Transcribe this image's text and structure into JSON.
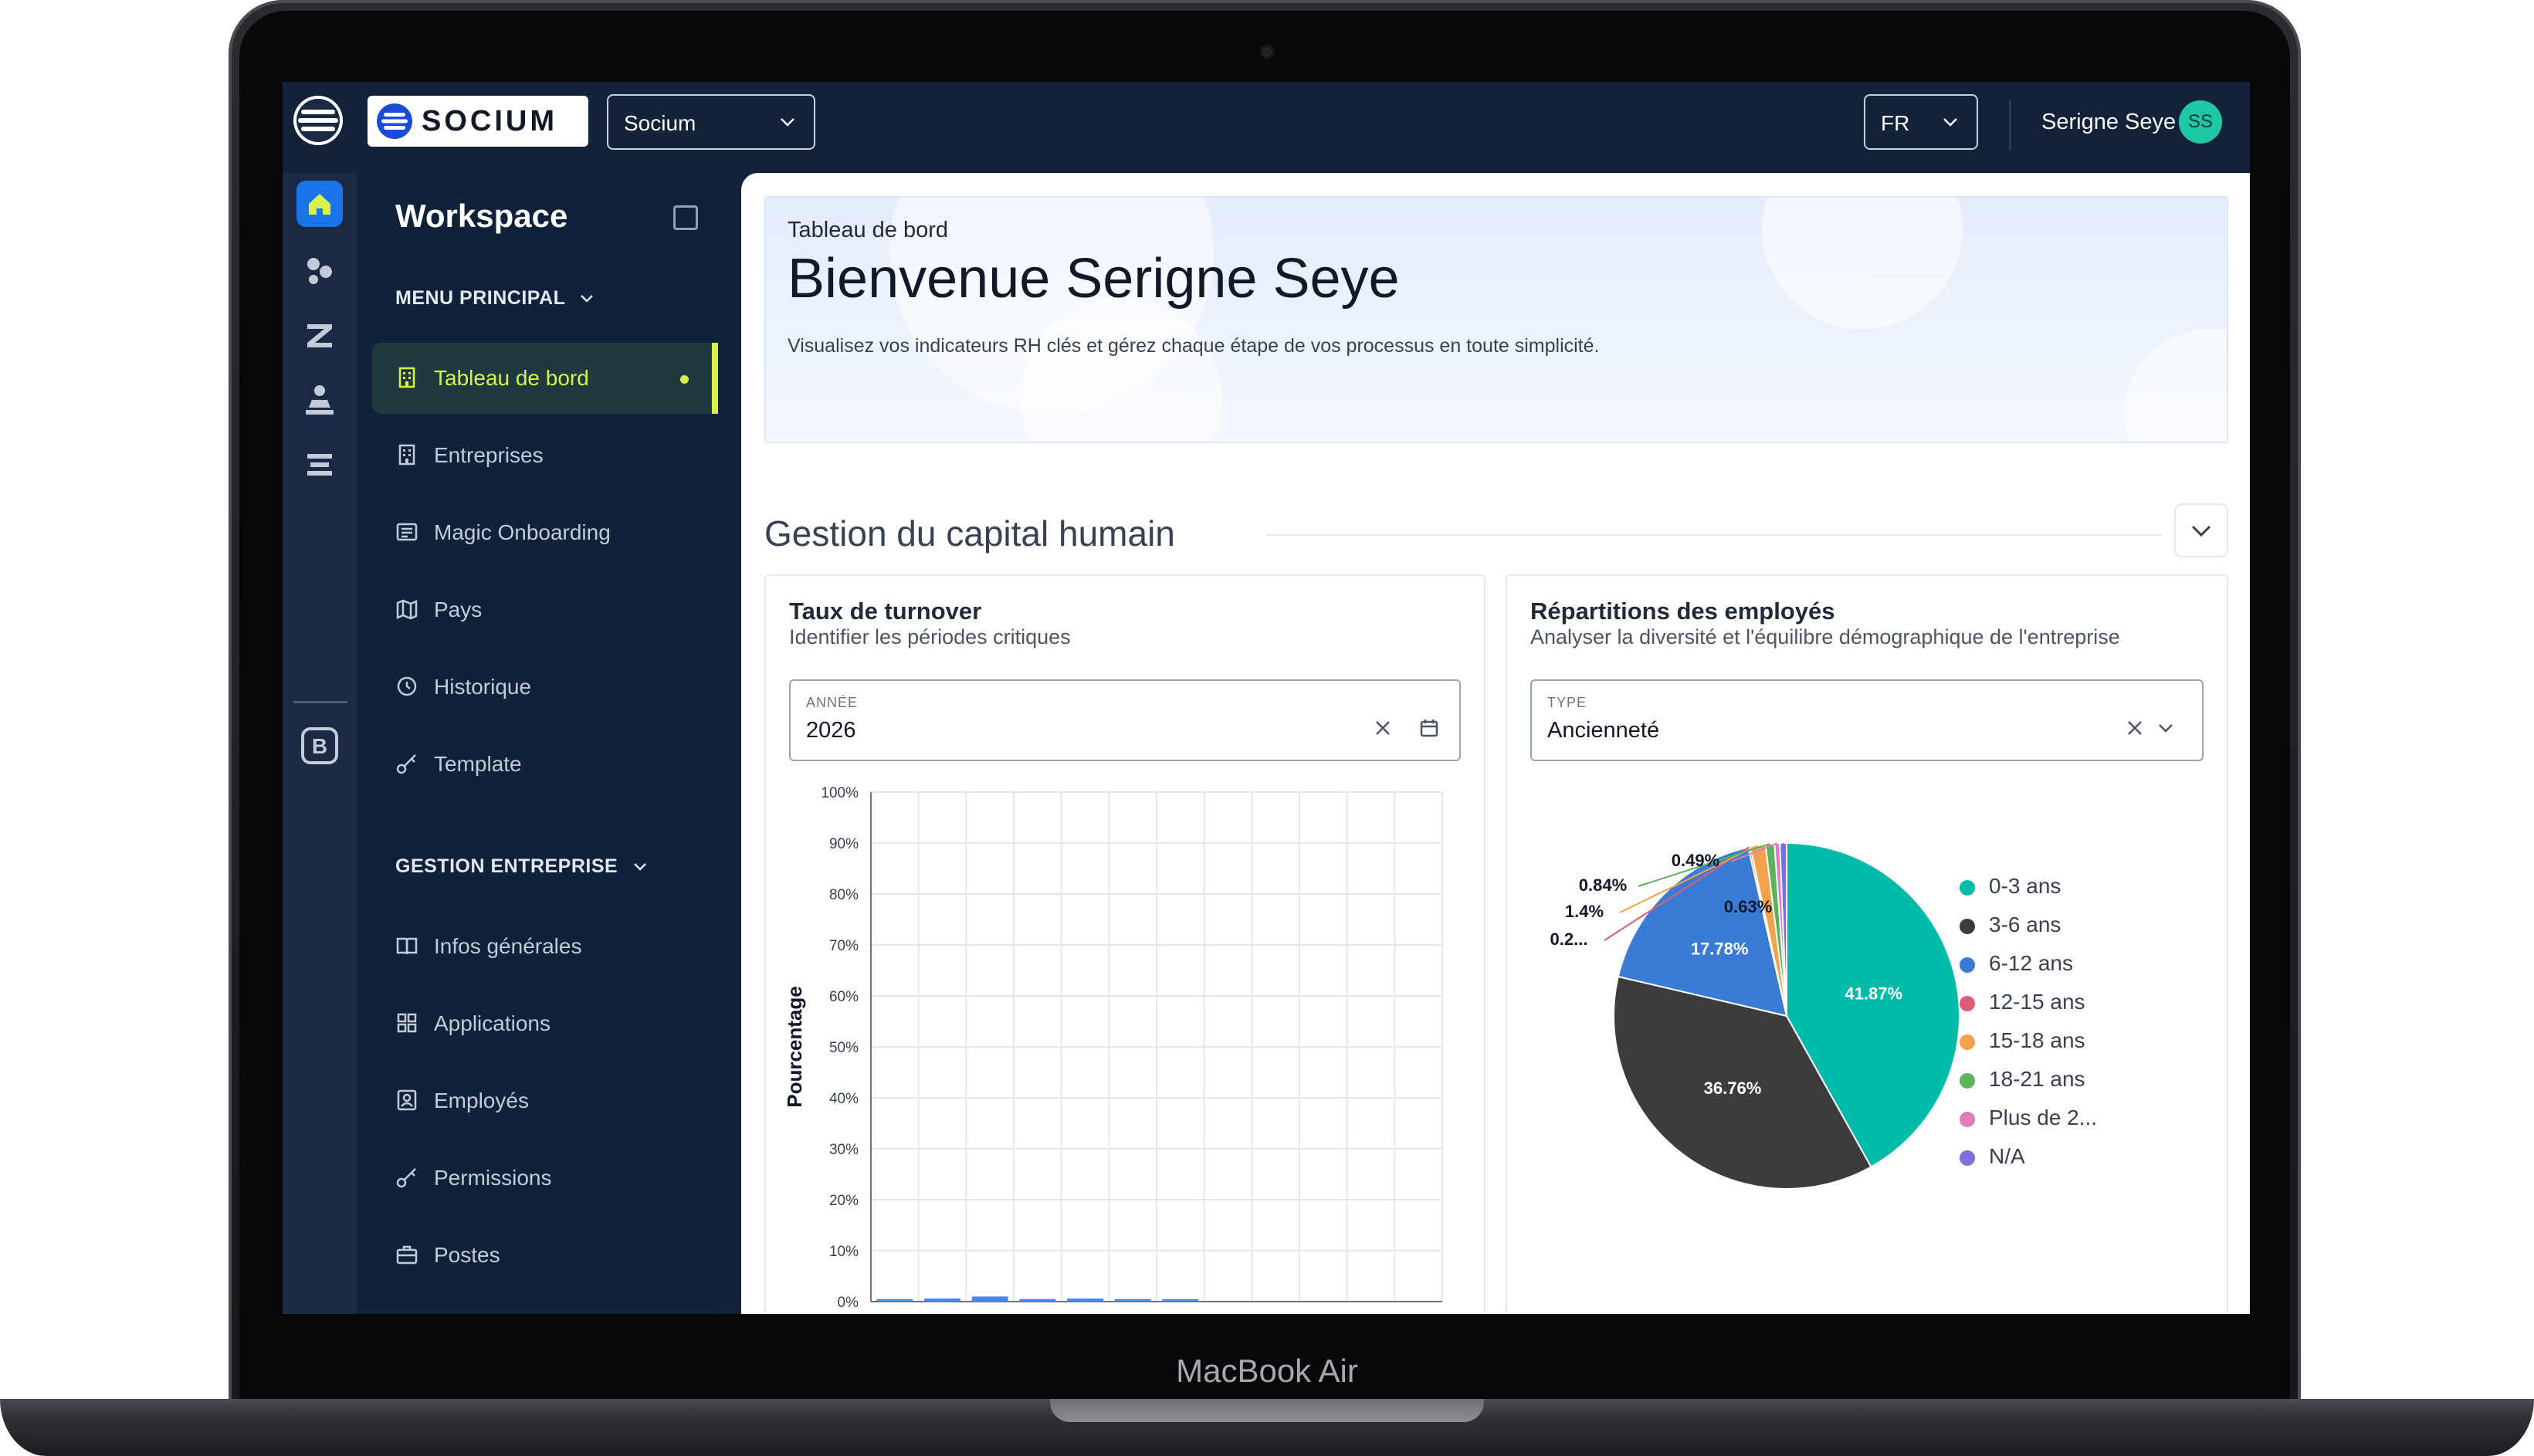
{
  "device": {
    "model_label": "MacBook Air"
  },
  "header": {
    "logo_text": "SOCIUM",
    "org_select": "Socium",
    "lang_select": "FR",
    "user_name": "Serigne Seye",
    "user_initials": "SS"
  },
  "sidebar": {
    "title": "Workspace",
    "menu_principal": "MENU PRINCIPAL",
    "gestion_entreprise": "GESTION ENTREPRISE",
    "items_principal": [
      {
        "label": "Tableau de bord",
        "icon": "building-icon",
        "active": true
      },
      {
        "label": "Entreprises",
        "icon": "office-icon"
      },
      {
        "label": "Magic Onboarding",
        "icon": "list-card-icon"
      },
      {
        "label": "Pays",
        "icon": "map-icon"
      },
      {
        "label": "Historique",
        "icon": "history-icon"
      },
      {
        "label": "Template",
        "icon": "key-icon"
      }
    ],
    "items_gestion": [
      {
        "label": "Infos générales",
        "icon": "book-icon"
      },
      {
        "label": "Applications",
        "icon": "grid-icon"
      },
      {
        "label": "Employés",
        "icon": "badge-icon"
      },
      {
        "label": "Permissions",
        "icon": "key-icon"
      },
      {
        "label": "Postes",
        "icon": "briefcase-icon"
      }
    ],
    "accent_color": "#d7f24a"
  },
  "hero": {
    "breadcrumb": "Tableau de bord",
    "title": "Bienvenue Serigne Seye",
    "subtitle": "Visualisez vos indicateurs RH clés et gérez chaque étape de vos processus en toute simplicité."
  },
  "section": {
    "title": "Gestion du capital humain"
  },
  "turnover_card": {
    "title": "Taux de turnover",
    "subtitle": "Identifier les périodes critiques",
    "field_label": "ANNÉE",
    "field_value": "2026"
  },
  "repartition_card": {
    "title": "Répartitions des employés",
    "subtitle": "Analyser la diversité et l'équilibre démographique de l'entreprise",
    "field_label": "TYPE",
    "field_value": "Ancienneté"
  },
  "chart_data": [
    {
      "type": "bar",
      "ylabel": "Pourcentage",
      "ylim": [
        0,
        100
      ],
      "y_ticks": [
        "0%",
        "10%",
        "20%",
        "30%",
        "40%",
        "50%",
        "60%",
        "70%",
        "80%",
        "90%",
        "100%"
      ],
      "values": [
        0.4,
        0.6,
        1.0,
        0.5,
        0.6,
        0.3,
        0.4,
        0.0,
        0.0,
        0.0,
        0.0,
        0.0
      ],
      "grid": true,
      "color": "#4a86e8"
    },
    {
      "type": "pie",
      "legend_position": "right",
      "slices": [
        {
          "label": "0-3 ans",
          "value": 41.87,
          "display": "41.87%",
          "color": "#00bba8"
        },
        {
          "label": "3-6 ans",
          "value": 36.76,
          "display": "36.76%",
          "color": "#3c3c3c"
        },
        {
          "label": "6-12 ans",
          "value": 17.78,
          "display": "17.78%",
          "color": "#3a7bd5"
        },
        {
          "label": "12-15 ans",
          "value": 0.2,
          "display": "0.2...",
          "color": "#e05a7a"
        },
        {
          "label": "15-18 ans",
          "value": 1.4,
          "display": "1.4%",
          "color": "#f2a24a"
        },
        {
          "label": "18-21 ans",
          "value": 0.84,
          "display": "0.84%",
          "color": "#5bb35b"
        },
        {
          "label": "Plus de 2...",
          "value": 0.49,
          "display": "0.49%",
          "color": "#e07bc0"
        },
        {
          "label": "N/A",
          "value": 0.63,
          "display": "0.63%",
          "color": "#7b6fe0"
        }
      ]
    }
  ]
}
